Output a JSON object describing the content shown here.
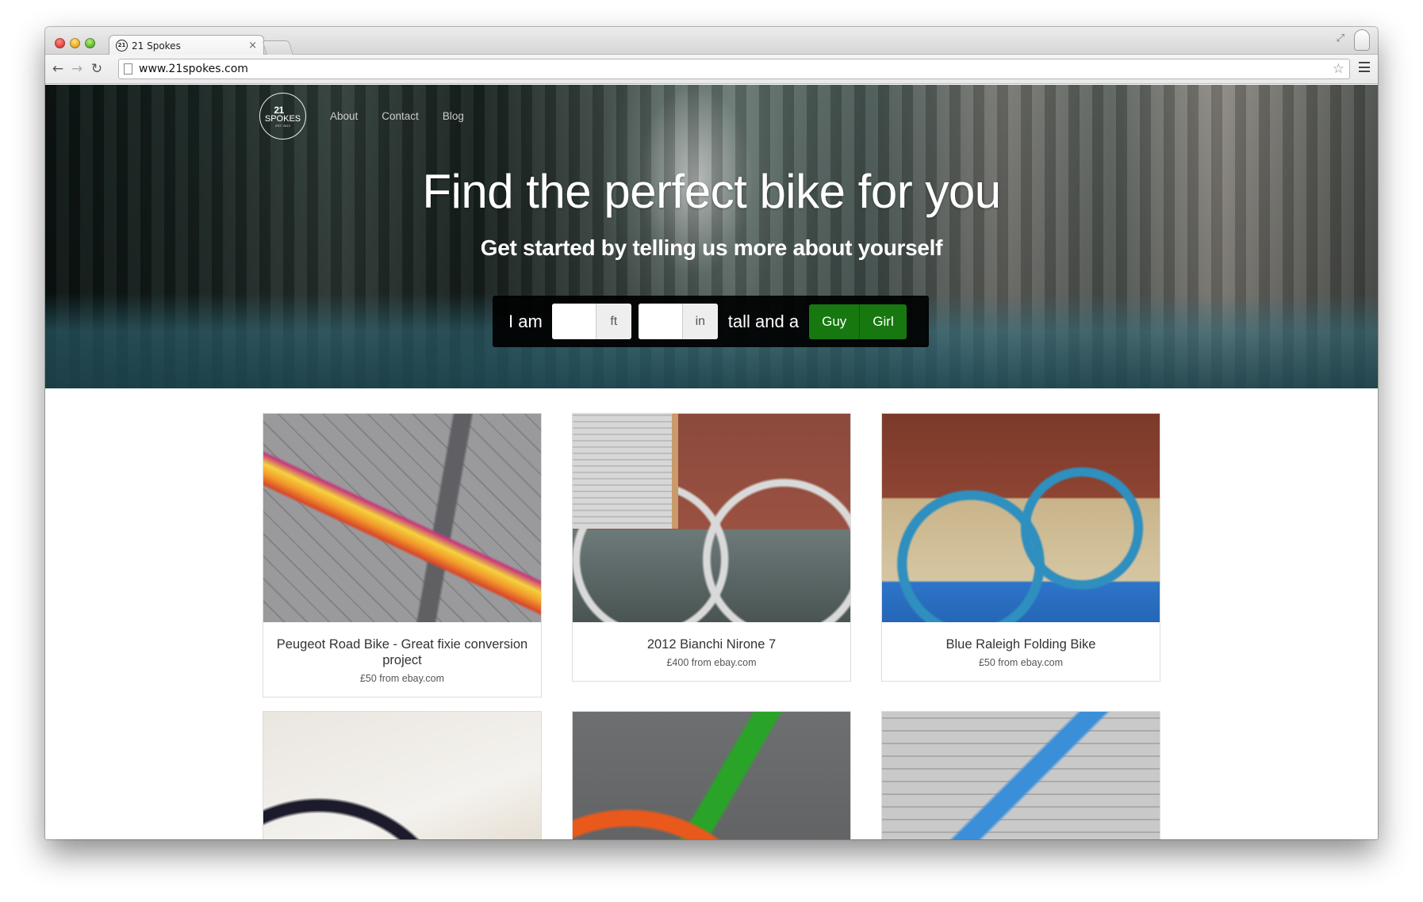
{
  "browser": {
    "tab_title": "21 Spokes",
    "favicon_text": "21",
    "tab_close": "×",
    "url": "www.21spokes.com"
  },
  "nav": {
    "logo_number": "21",
    "logo_word": "SPOKES",
    "logo_sub": "EST. 2013",
    "links": [
      "About",
      "Contact",
      "Blog"
    ]
  },
  "hero": {
    "title": "Find the perfect bike for you",
    "subtitle": "Get started by telling us more about yourself",
    "form": {
      "prefix": "I am",
      "feet_value": "",
      "feet_unit": "ft",
      "inches_value": "",
      "inches_unit": "in",
      "middle": "tall and a",
      "options": [
        "Guy",
        "Girl"
      ]
    }
  },
  "bikes": [
    {
      "title": "Peugeot Road Bike - Great fixie conversion project",
      "price": "£50 from ebay.com"
    },
    {
      "title": "2012 Bianchi Nirone 7",
      "price": "£400 from ebay.com"
    },
    {
      "title": "Blue Raleigh Folding Bike",
      "price": "£50 from ebay.com"
    },
    {
      "title": "",
      "price": ""
    },
    {
      "title": "",
      "price": ""
    },
    {
      "title": "",
      "price": ""
    }
  ],
  "colors": {
    "accent_button": "#16780f",
    "form_bar": "#000000"
  }
}
